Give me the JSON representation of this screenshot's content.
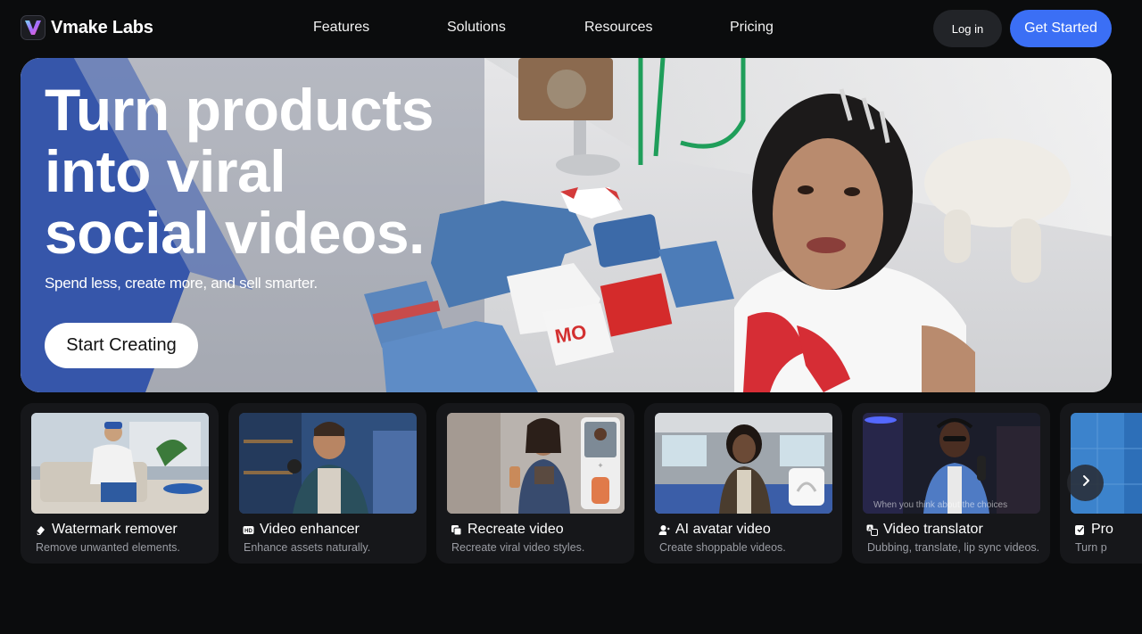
{
  "brand": {
    "name": "Vmake Labs",
    "accent": "#3b6ff5"
  },
  "nav": {
    "links": [
      "Features",
      "Solutions",
      "Resources",
      "Pricing"
    ],
    "login_label": "Log in",
    "cta_label": "Get Started"
  },
  "hero": {
    "title_lines": [
      "Turn products",
      "into viral",
      "social videos."
    ],
    "subtitle": "Spend less, create more, and sell smarter.",
    "cta_label": "Start Creating"
  },
  "cards": [
    {
      "icon": "eraser-icon",
      "title": "Watermark remover",
      "desc": "Remove unwanted elements."
    },
    {
      "icon": "hd-icon",
      "title": "Video enhancer",
      "desc": "Enhance assets naturally."
    },
    {
      "icon": "copy-icon",
      "title": "Recreate video",
      "desc": "Recreate viral video styles."
    },
    {
      "icon": "avatar-icon",
      "title": "AI avatar video",
      "desc": "Create shoppable videos."
    },
    {
      "icon": "translate-icon",
      "title": "Video translator",
      "desc": "Dubbing, translate, lip sync videos.",
      "caption": "When you think about the choices"
    },
    {
      "icon": "product-icon",
      "title": "Pro",
      "desc": "Turn p"
    }
  ],
  "carousel": {
    "next_icon": "chevron-right-icon"
  }
}
